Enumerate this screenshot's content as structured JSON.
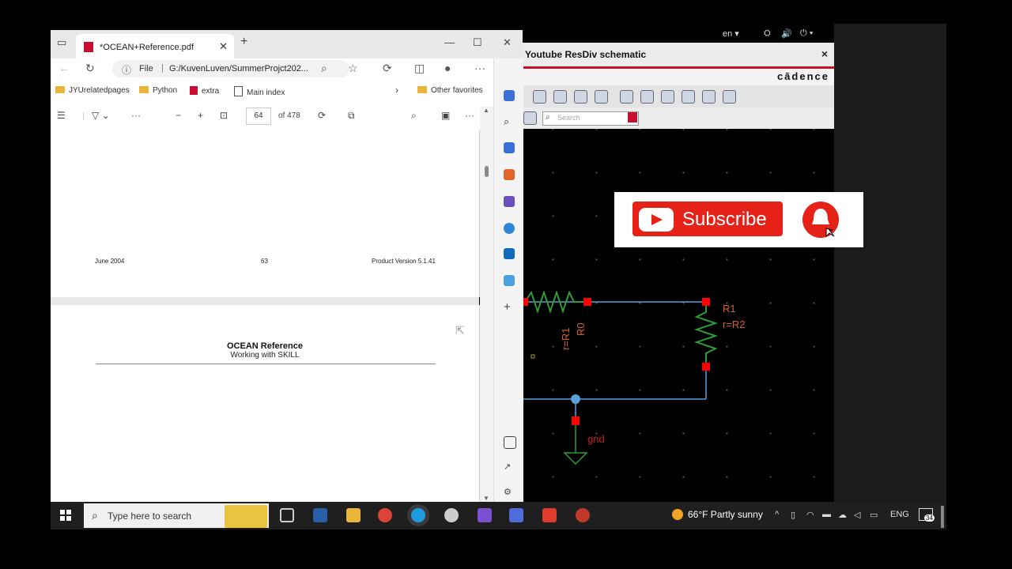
{
  "linux_bar": {
    "lang": "en ▾",
    "icons": [
      "network-icon",
      "volume-icon",
      "power-icon"
    ]
  },
  "cadence": {
    "window_title": "Youtube ResDiv schematic",
    "close": "×",
    "logo": "cādence",
    "search_placeholder": "Search",
    "labels": {
      "r0_param": "r=R1",
      "r0_name": "R0",
      "r1_name": "R1",
      "r1_param": "r=R2",
      "gnd": "gnd"
    }
  },
  "overlay": {
    "subscribe": "Subscribe",
    "icon": "bell-icon"
  },
  "browser": {
    "tab_title": "*OCEAN+Reference.pdf",
    "new_tab": "+",
    "address_file": "File",
    "address_url": "G:/KuvenLuven/SummerProjct202...",
    "favorites": [
      "JYUrelatedpages",
      "Python",
      "extra",
      "Main index",
      "Other favorites"
    ],
    "page_number": "64",
    "page_total": "of 478",
    "zoom_minus": "−",
    "zoom_plus": "+",
    "more": "···"
  },
  "pdf": {
    "footer_left": "June 2004",
    "footer_center": "63",
    "footer_right": "Product Version 5.1.41",
    "doc_title": "OCEAN Reference",
    "doc_subtitle": "Working with SKILL"
  },
  "taskbar": {
    "search_placeholder": "Type here to search",
    "weather": "66°F  Partly sunny",
    "lang": "ENG",
    "notifications": "34"
  },
  "colors": {
    "cadence_red": "#c8102e",
    "wire_blue": "#5aa0d8",
    "pin_red": "#ff0000",
    "resistor_orange": "#d2642a",
    "gnd_green": "#2e9a3a",
    "youtube_red": "#e62117"
  }
}
